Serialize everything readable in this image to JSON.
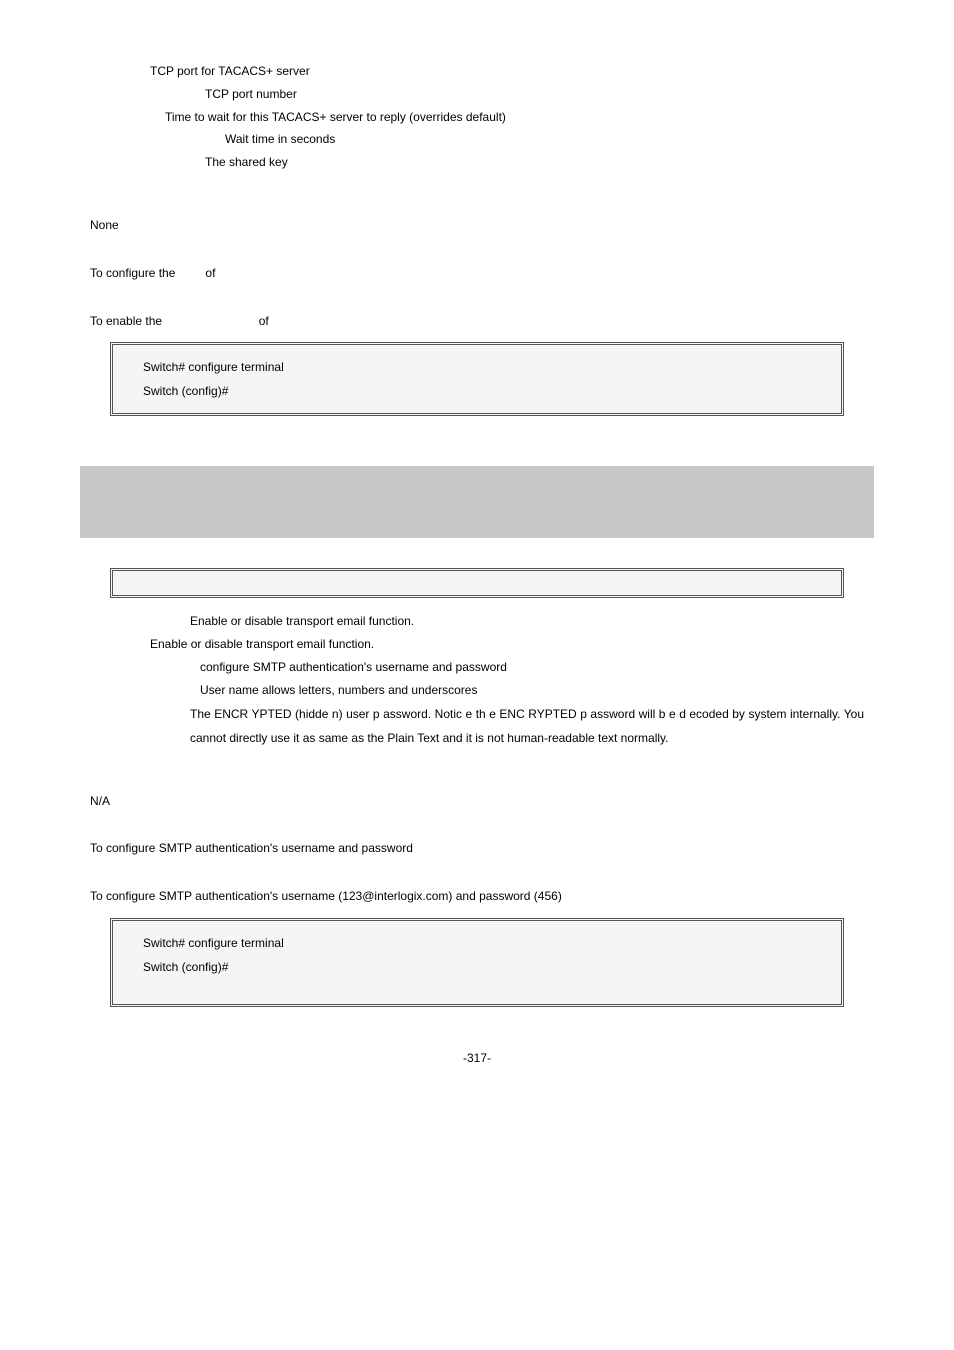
{
  "top_params": {
    "l1": "TCP port for TACACS+ server",
    "l2": "TCP port number",
    "l3": "Time to wait for this TACACS+ server to reply (overrides default)",
    "l4": "Wait time in seconds",
    "l5": "The shared key"
  },
  "top_default": {
    "label": "None"
  },
  "top_usage": {
    "intro": "To configure the",
    "mid": "of"
  },
  "top_example": {
    "intro": "To enable the",
    "mid": "of"
  },
  "code1": {
    "line1": "Switch# configure terminal",
    "line2": "Switch (config)#"
  },
  "section2": {
    "desc1": "Enable or disable transport email function.",
    "desc2": "Enable or disable transport email function.",
    "auth_label": " configure SMTP authentication's username and password",
    "user_label": " User name allows letters, numbers and underscores",
    "pass_label": "The ENCR YPTED (hidde n) user p  assword. Notic e th e ENC RYPTED p assword  will b e d ecoded  by system internally. You cannot directly use it as same as the Plain Text and it is not human-readable text normally."
  },
  "default2": {
    "label": "N/A"
  },
  "usage2": {
    "text": "To configure SMTP authentication's username and password"
  },
  "example2": {
    "text": "To configure SMTP authentication's username (123@interlogix.com) and password (456)"
  },
  "code2": {
    "line1": "Switch# configure terminal",
    "line2": "Switch (config)#"
  },
  "page": "-317-"
}
